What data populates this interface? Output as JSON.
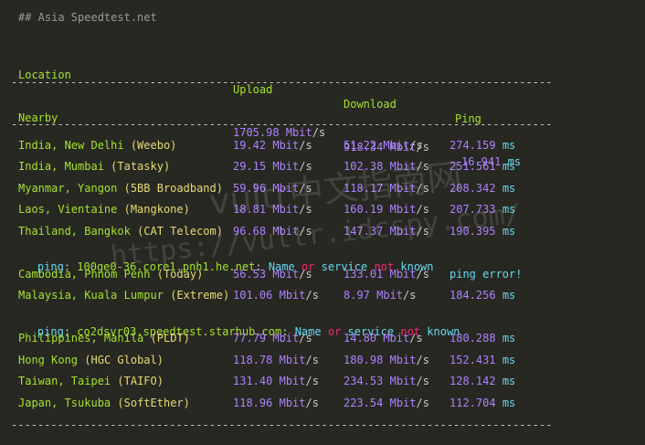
{
  "title": "## Asia Speedtest.net",
  "headers": {
    "location": "Location",
    "upload": "Upload",
    "download": "Download",
    "ping": "Ping"
  },
  "separator": "----------------------------------------------------------------------------------",
  "nearby": {
    "location": "Nearby",
    "upload": "1705.98",
    "download": "918.34",
    "ping": "16.941"
  },
  "units": {
    "speed": "Mbit",
    "slash": "/s",
    "ms": "ms"
  },
  "rows": [
    {
      "country": "India, New Delhi",
      "isp": "(Weebo)",
      "upload": "19.42",
      "download": "51.22",
      "ping": "274.159"
    },
    {
      "country": "India, Mumbai",
      "isp": "(Tatasky)",
      "upload": "29.15",
      "download": "102.38",
      "ping": "251.561"
    },
    {
      "country": "Myanmar, Yangon",
      "isp": "(5BB Broadband)",
      "upload": "59.96",
      "download": "118.17",
      "ping": "208.342"
    },
    {
      "country": "Laos, Vientaine",
      "isp": "(Mangkone)",
      "upload": "18.81",
      "download": "160.19",
      "ping": "207.733"
    },
    {
      "country": "Thailand, Bangkok",
      "isp": "(CAT Telecom)",
      "upload": "96.68",
      "download": "147.37",
      "ping": "190.395"
    }
  ],
  "error1": {
    "ping": "ping",
    "host": "100ge0-36.core1.pnh1.he.net",
    "colon": ":",
    "name": "Name",
    "or": "or",
    "service": "service",
    "not": "not",
    "known": "known"
  },
  "rows2": [
    {
      "country": "Cambodia, Phnom Penh",
      "isp": "(Today)",
      "upload": "56.53",
      "download": "133.01",
      "ping_error": "ping error!"
    },
    {
      "country": "Malaysia, Kuala Lumpur",
      "isp": "(Extreme)",
      "upload": "101.06",
      "download": "8.97",
      "ping": "184.256"
    }
  ],
  "error2": {
    "ping": "ping",
    "host": "co2dsvr03.speedtest.starhub.com",
    "colon": ":",
    "name": "Name",
    "or": "or",
    "service": "service",
    "not": "not",
    "known": "known"
  },
  "rows3": [
    {
      "country": "Philippines, Manila",
      "isp": "(PLDT)",
      "upload": "77.79",
      "download": "14.80",
      "ping": "180.288"
    },
    {
      "country": "Hong Kong",
      "isp": "(HGC Global)",
      "upload": "118.78",
      "download": "180.98",
      "ping": "152.431"
    },
    {
      "country": "Taiwan, Taipei",
      "isp": "(TAIFO)",
      "upload": "131.40",
      "download": "234.53",
      "ping": "128.142"
    },
    {
      "country": "Japan, Tsukuba",
      "isp": "(SoftEther)",
      "upload": "118.96",
      "download": "223.54",
      "ping": "112.704"
    }
  ],
  "watermark": {
    "cn": "vultr中文指南网",
    "url": "https://vultr.idcspy.com/"
  }
}
